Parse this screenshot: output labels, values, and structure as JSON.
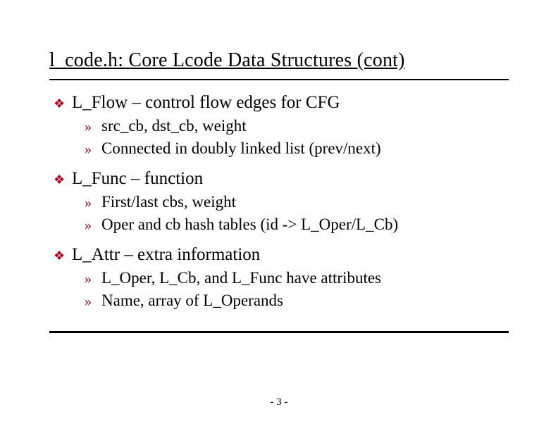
{
  "title": "l_code.h: Core Lcode Data Structures (cont)",
  "bullets": [
    {
      "text": "L_Flow – control flow edges for CFG",
      "sub": [
        "src_cb, dst_cb, weight",
        "Connected in doubly linked list (prev/next)"
      ]
    },
    {
      "text": "L_Func – function",
      "sub": [
        "First/last cbs, weight",
        "Oper and cb hash tables (id -> L_Oper/L_Cb)"
      ]
    },
    {
      "text": "L_Attr – extra information",
      "sub": [
        "L_Oper, L_Cb, and L_Func have attributes",
        "Name, array of L_Operands"
      ]
    }
  ],
  "page_number": "- 3 -",
  "markers": {
    "level1": "❖",
    "level2": "»"
  }
}
